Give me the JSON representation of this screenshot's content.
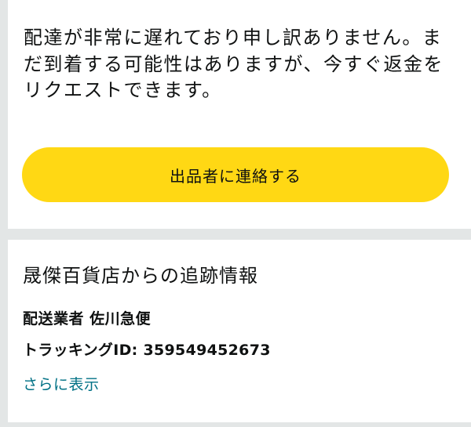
{
  "delay_notice": {
    "message": "配達が非常に遅れており申し訳ありません。まだ到着する可能性はありますが、今すぐ返金をリクエストできます。",
    "contact_button_label": "出品者に連絡する"
  },
  "tracking": {
    "title": "晟傑百貨店からの追跡情報",
    "carrier_label": "配送業者",
    "carrier_name": "佐川急便",
    "tracking_id_label": "トラッキングID:",
    "tracking_id": "359549452673",
    "show_more_label": "さらに表示"
  },
  "colors": {
    "button": "#ffd814",
    "link": "#007185",
    "background": "#e3e6e6"
  }
}
